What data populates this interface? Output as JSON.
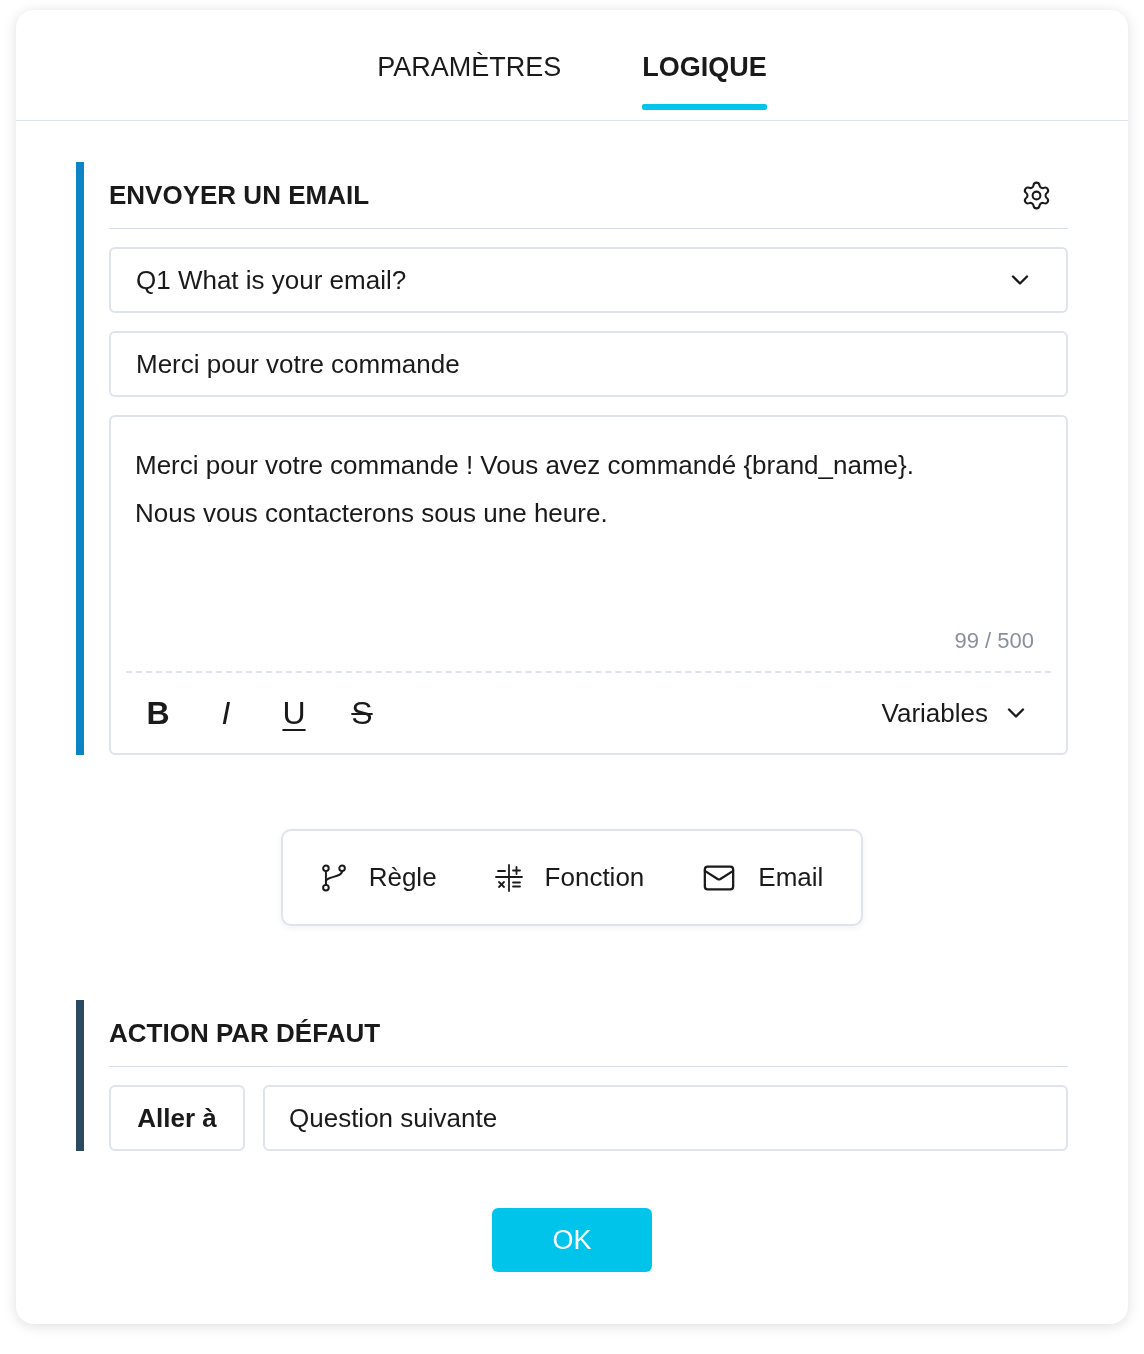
{
  "tabs": [
    {
      "label": "PARAMÈTRES",
      "selected": false
    },
    {
      "label": "LOGIQUE",
      "selected": true
    }
  ],
  "email_action": {
    "title": "ENVOYER UN EMAIL",
    "recipient_select": {
      "value": "Q1 What is your email?"
    },
    "subject": {
      "value": "Merci pour votre commande"
    },
    "message": {
      "paragraphs": [
        "Merci pour votre commande ! Vous avez commandé {brand_name}.",
        "Nous vous contacterons sous une heure."
      ],
      "counter": "99 / 500"
    },
    "format_buttons": [
      {
        "label": "B",
        "kind": "bold"
      },
      {
        "label": "I",
        "kind": "italic"
      },
      {
        "label": "U",
        "kind": "underline"
      },
      {
        "label": "S",
        "kind": "strikethrough"
      }
    ],
    "variables_menu": "Variables"
  },
  "add_buttons": [
    {
      "label": "Règle",
      "kind": "rule"
    },
    {
      "label": "Fonction",
      "kind": "function"
    },
    {
      "label": "Email",
      "kind": "email"
    }
  ],
  "default_action": {
    "title": "ACTION PAR DÉFAUT",
    "action_label": "Aller à",
    "target": {
      "value": "Question suivante"
    }
  },
  "ok_button": "OK"
}
